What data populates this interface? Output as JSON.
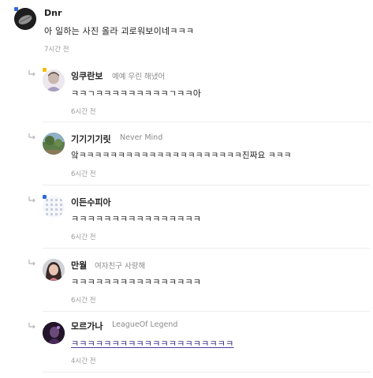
{
  "comments": [
    {
      "name": "Dnr",
      "status": "",
      "text": "아 일하는 사진 올라 괴로워보이네ㅋㅋㅋ",
      "time": "7시간 전",
      "avatar": "leaf-avatar"
    },
    {
      "name": "잉쿠란보",
      "status": "예예 우린 해냈어",
      "text": "ㅋㅋㄱㅋㅋㅋㅋㅋㅋㅋㅋㅋㄱㅋㅋ아",
      "time": "6시간 전",
      "avatar": "person-avatar"
    },
    {
      "name": "기기기기릿",
      "status": "Never Mind",
      "text": "앜ㅋㅋㅋㅋㅋㅋㅋㅋㅋㅋㅋㅋㅋㅋㅋㅋㅋㅋㅋㅋㅋ진짜요 ㅋㅋㅋ",
      "time": "6시간 전",
      "avatar": "landscape-avatar"
    },
    {
      "name": "이든수피아",
      "status": "",
      "text": "ㅋㅋㅋㅋㅋㅋㅋㅋㅋㅋㅋㅋㅋㅋㅋㅋ",
      "time": "6시간 전",
      "avatar": "pattern-avatar"
    },
    {
      "name": "만월",
      "status": "여자친구 사랑해",
      "text": "ㅋㅋㅋㅋㅋㅋㅋㅋㅋㅋㅋㅋㅋㅋㅋㅋ",
      "time": "6시간 전",
      "avatar": "portrait-avatar"
    },
    {
      "name": "모르가나",
      "status": "LeagueOf Legend",
      "text": "ㅋㅋㅋㅋㅋㅋㅋㅋㅋㅋㅋㅋㅋㅋㅋㅋㅋㅋㅋㅋ",
      "time": "4시간 전",
      "avatar": "dark-avatar"
    }
  ],
  "colors": {
    "badge": "#2f6bd6",
    "link_text": "#3b2a86",
    "muted": "#8a8a8a"
  }
}
